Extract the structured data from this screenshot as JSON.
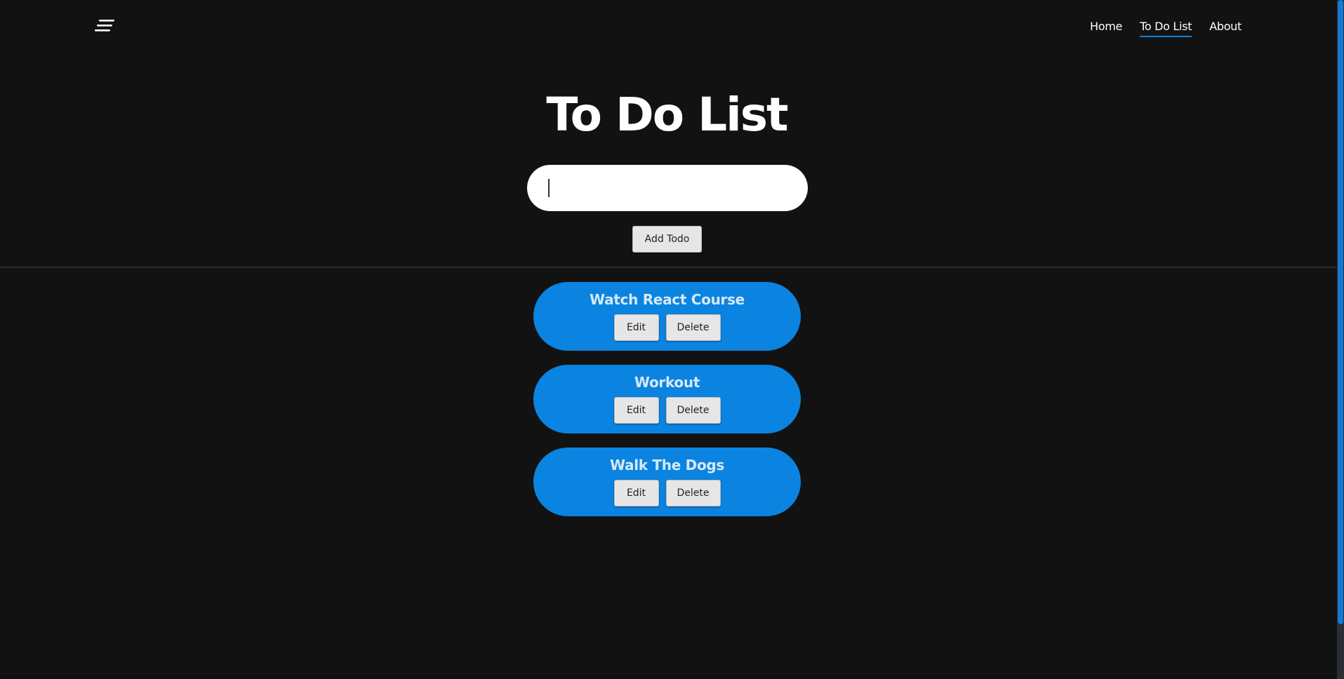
{
  "nav": {
    "logo_icon": "menu-lines-icon",
    "links": [
      {
        "label": "Home",
        "active": false
      },
      {
        "label": "To Do List",
        "active": true
      },
      {
        "label": "About",
        "active": false
      }
    ]
  },
  "main": {
    "title": "To Do List",
    "input": {
      "value": "",
      "placeholder": ""
    },
    "add_button_label": "Add Todo"
  },
  "todos": [
    {
      "text": "Watch React Course",
      "edit_label": "Edit",
      "delete_label": "Delete"
    },
    {
      "text": "Workout",
      "edit_label": "Edit",
      "delete_label": "Delete"
    },
    {
      "text": "Walk The Dogs",
      "edit_label": "Edit",
      "delete_label": "Delete"
    }
  ],
  "colors": {
    "background": "#121212",
    "accent": "#0a84e0",
    "todo_text": "#d8e8f8"
  }
}
